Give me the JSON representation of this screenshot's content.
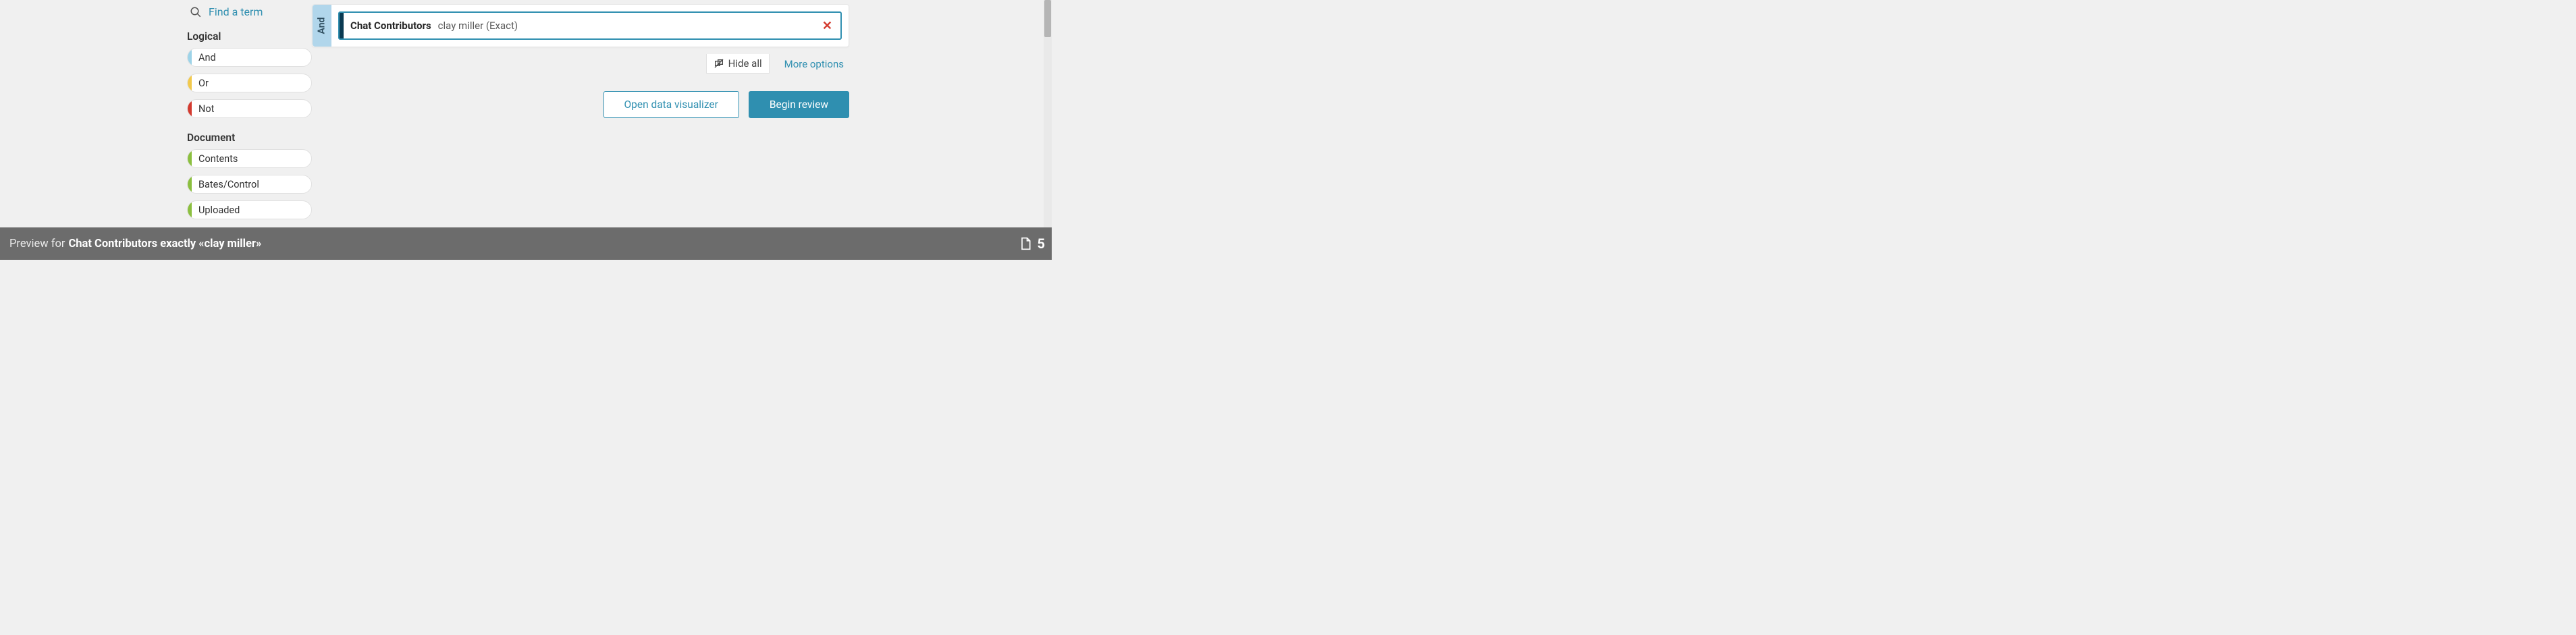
{
  "search": {
    "find_label": "Find a term"
  },
  "sections": {
    "logical": {
      "title": "Logical",
      "items": [
        {
          "label": "And",
          "stripe": "stripe-and"
        },
        {
          "label": "Or",
          "stripe": "stripe-or"
        },
        {
          "label": "Not",
          "stripe": "stripe-not"
        }
      ]
    },
    "document": {
      "title": "Document",
      "items": [
        {
          "label": "Contents",
          "stripe": "stripe-doc"
        },
        {
          "label": "Bates/Control",
          "stripe": "stripe-doc"
        },
        {
          "label": "Uploaded",
          "stripe": "stripe-doc"
        }
      ]
    }
  },
  "query": {
    "operator_label": "And",
    "field": "Chat Contributors",
    "value": "clay miller (Exact)"
  },
  "controls": {
    "hide_all": "Hide all",
    "more_options": "More options"
  },
  "actions": {
    "visualizer": "Open data visualizer",
    "review": "Begin review"
  },
  "footer": {
    "prefix": "Preview for",
    "strong": "Chat Contributors exactly «clay miller»",
    "count": "5"
  }
}
